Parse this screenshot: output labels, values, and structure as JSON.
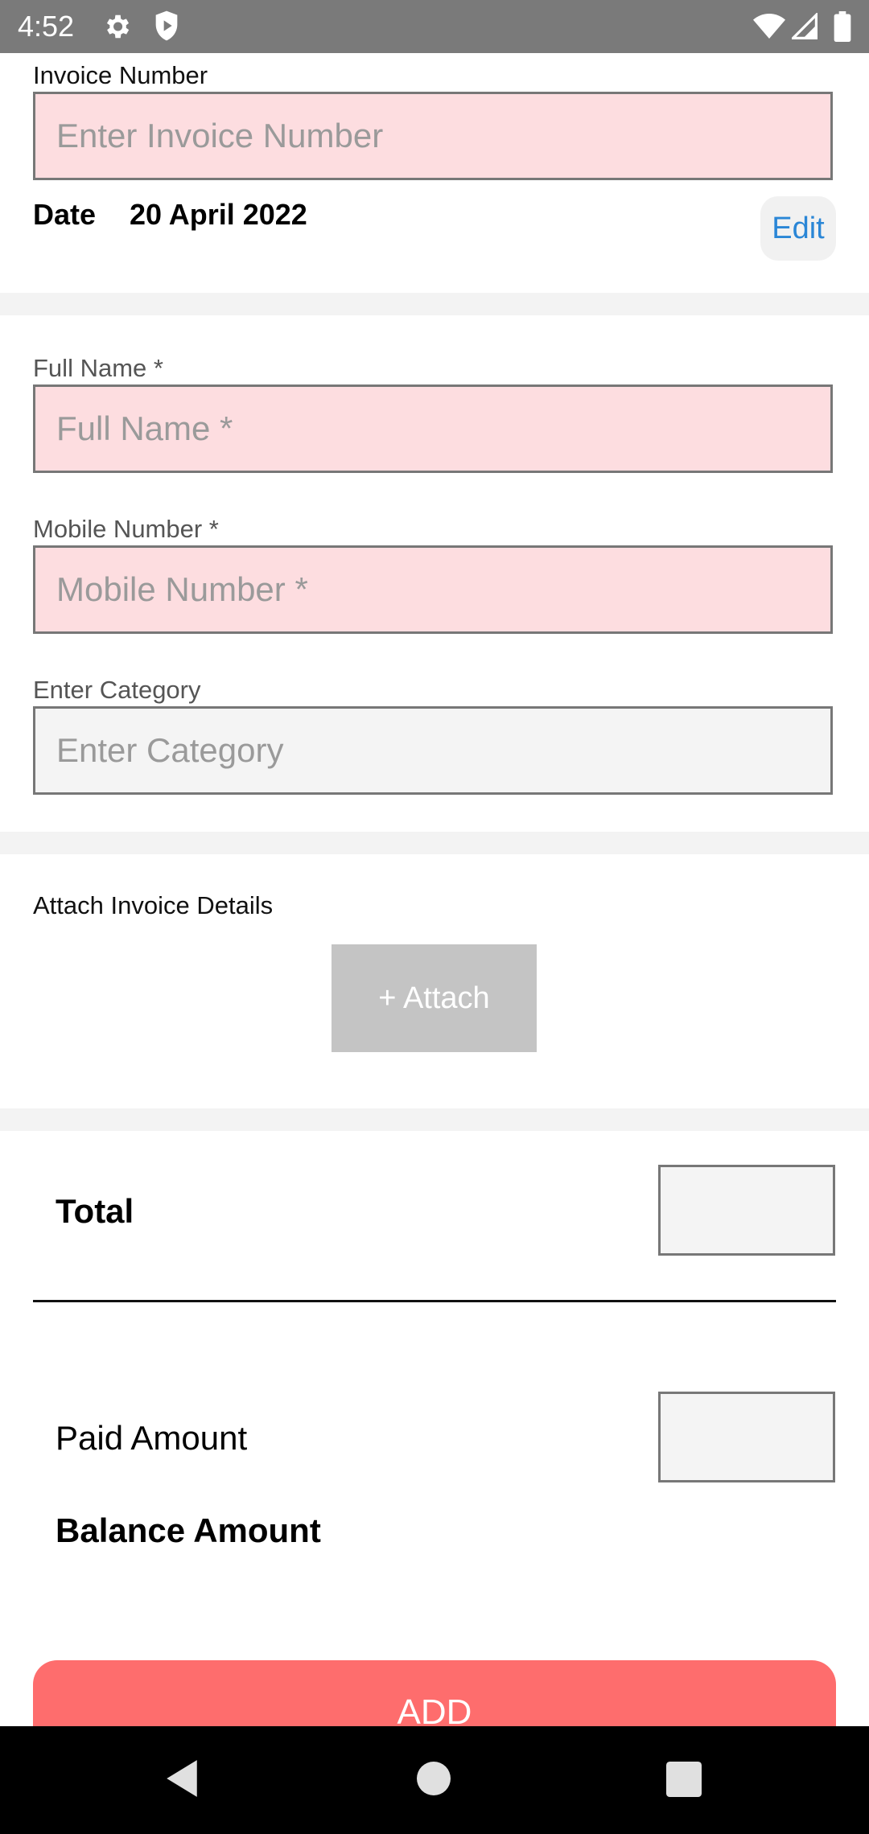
{
  "status_bar": {
    "time": "4:52",
    "icons": [
      "gear-icon",
      "shield-icon",
      "wifi-icon",
      "signal-icon",
      "battery-icon"
    ]
  },
  "invoice": {
    "label": "Invoice Number",
    "placeholder": "Enter Invoice Number",
    "date_label": "Date",
    "date_value": "20 April 2022",
    "edit_label": "Edit"
  },
  "customer": {
    "full_name_label": "Full Name *",
    "full_name_placeholder": "Full Name *",
    "mobile_label": "Mobile Number *",
    "mobile_placeholder": "Mobile Number *",
    "category_label": "Enter Category",
    "category_placeholder": "Enter Category"
  },
  "attachments": {
    "label": "Attach Invoice Details",
    "button_label": "+ Attach"
  },
  "summary": {
    "total_label": "Total",
    "paid_label": "Paid Amount",
    "balance_label": "Balance Amount"
  },
  "actions": {
    "add_label": "ADD"
  },
  "colors": {
    "required_field_bg": "#fddde0",
    "optional_field_bg": "#f4f4f4",
    "edit_link": "#2a86d6",
    "add_button": "#fe6d6d",
    "attach_button": "#c4c4c4",
    "status_bar": "#7a7a7a"
  },
  "nav_bar": {
    "icons": [
      "back-icon",
      "home-icon",
      "recents-icon"
    ]
  }
}
